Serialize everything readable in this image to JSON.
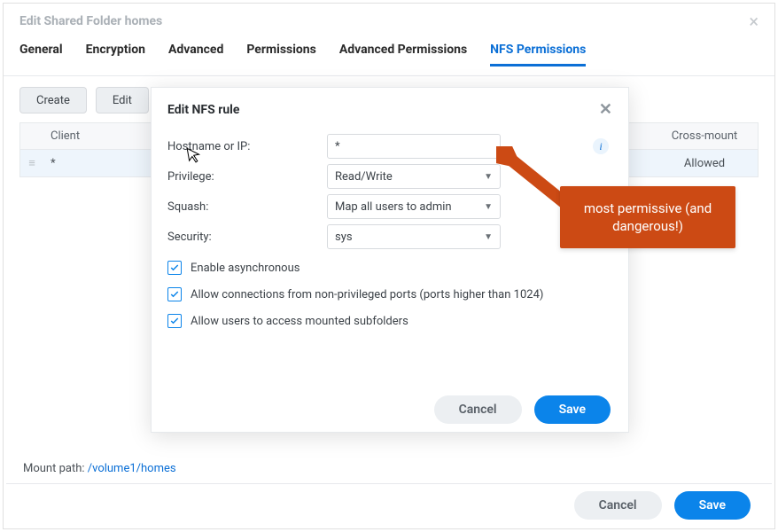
{
  "outer": {
    "title": "Edit Shared Folder homes",
    "tabs": [
      "General",
      "Encryption",
      "Advanced",
      "Permissions",
      "Advanced Permissions",
      "NFS Permissions"
    ],
    "active_tab_index": 5,
    "toolbar": {
      "create": "Create",
      "edit": "Edit"
    },
    "grid": {
      "headers": {
        "client": "Client",
        "crossmount": "Cross-mount"
      },
      "row": {
        "client": "*",
        "crossmount": "Allowed"
      }
    },
    "mount_label": "Mount path: ",
    "mount_path": "/volume1/homes",
    "footer": {
      "cancel": "Cancel",
      "save": "Save"
    }
  },
  "modal": {
    "title": "Edit NFS rule",
    "fields": {
      "hostip_label": "Hostname or IP:",
      "hostip_value": "*",
      "privilege_label": "Privilege:",
      "privilege_value": "Read/Write",
      "squash_label": "Squash:",
      "squash_value": "Map all users to admin",
      "security_label": "Security:",
      "security_value": "sys"
    },
    "checks": {
      "async": "Enable asynchronous",
      "ports": "Allow connections from non-privileged ports (ports higher than 1024)",
      "subfolders": "Allow users to access mounted subfolders"
    },
    "footer": {
      "cancel": "Cancel",
      "save": "Save"
    }
  },
  "annotation": {
    "text": "most permissive (and dangerous!)"
  }
}
